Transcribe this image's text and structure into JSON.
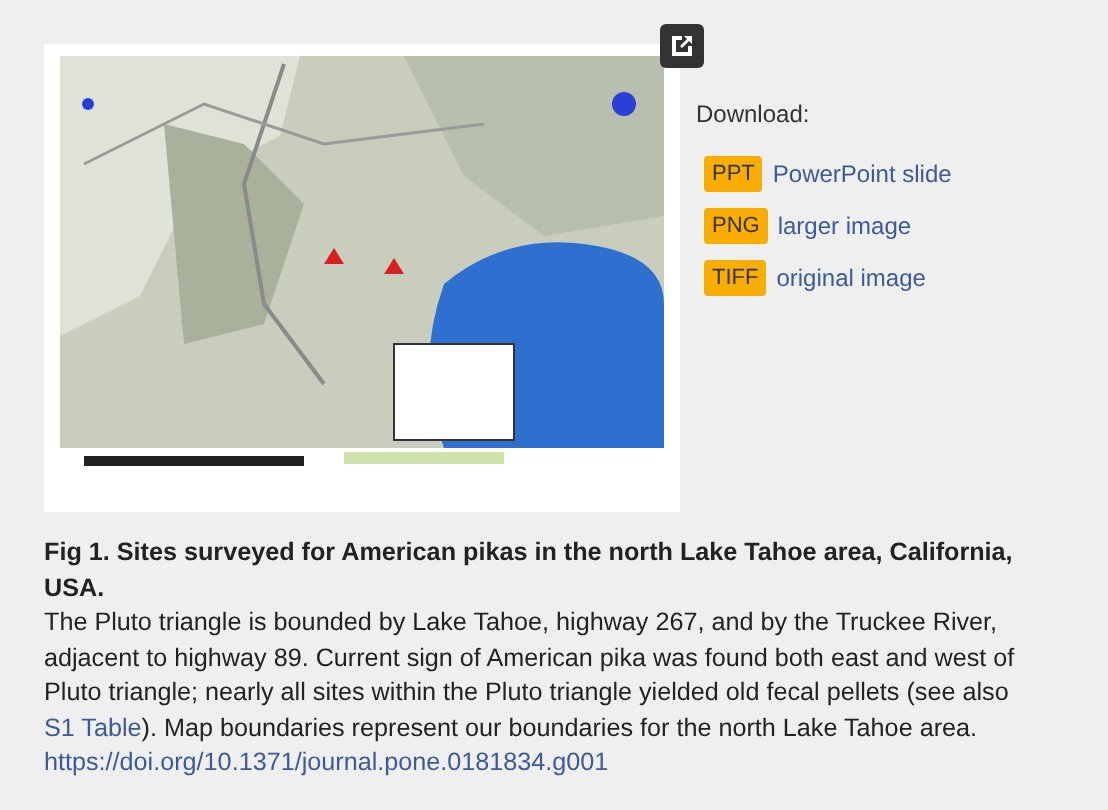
{
  "download": {
    "label": "Download:",
    "items": [
      {
        "badge": "PPT",
        "link": "PowerPoint slide"
      },
      {
        "badge": "PNG",
        "link": "larger image"
      },
      {
        "badge": "TIFF",
        "link": "original image"
      }
    ]
  },
  "caption": {
    "title": "Fig 1. Sites surveyed for American pikas in the north Lake Tahoe area, California, USA.",
    "text_before": "The Pluto triangle is bounded by Lake Tahoe, highway 267, and by the Truckee River, adjacent to highway 89. Current sign of American pika was found both east and west of Pluto triangle; nearly all sites within the Pluto triangle yielded old fecal pellets (see also ",
    "link": "S1 Table",
    "text_after": "). Map boundaries represent our boundaries for the north Lake Tahoe area.",
    "doi": "https://doi.org/10.1371/journal.pone.0181834.g001"
  }
}
